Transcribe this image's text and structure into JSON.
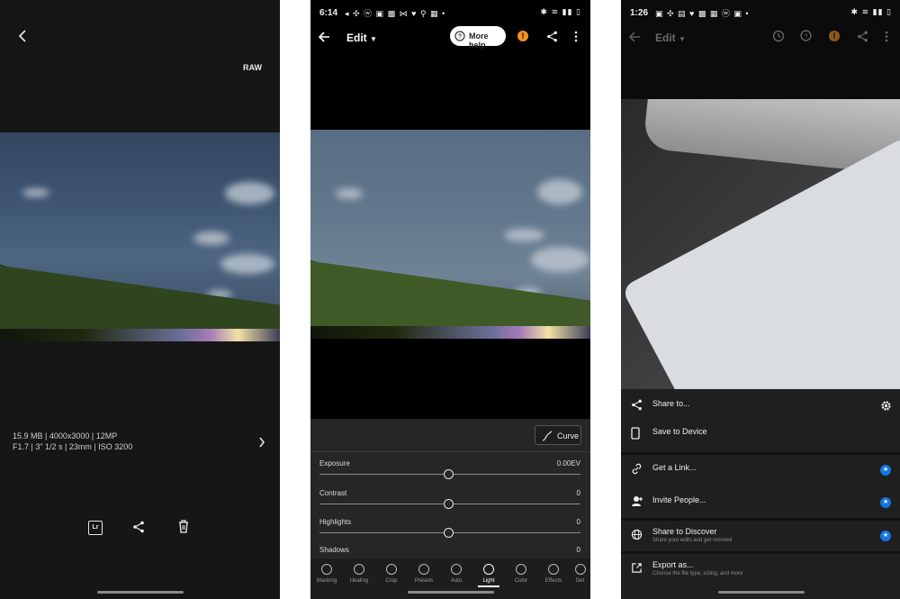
{
  "panel1": {
    "raw_badge": "RAW",
    "meta_line1": "15.9 MB  |  4000x3000  |  12MP",
    "meta_line2": "F1.7  |  3\" 1/2 s  |  23mm  |  ISO 3200",
    "actions": {
      "lr_label": "Lr"
    }
  },
  "panel2": {
    "status_time": "6:14",
    "status_left": "◂ ✣ ⓦ ▣ ▩ ⋈ ♥ ⚲ ▦ •",
    "status_right": "✱ ≋ ▮▮ ▯",
    "title": "Edit",
    "help_label": "More help",
    "curve_label": "Curve",
    "sliders": [
      {
        "label": "Exposure",
        "value": "0.00EV"
      },
      {
        "label": "Contrast",
        "value": "0"
      },
      {
        "label": "Highlights",
        "value": "0"
      },
      {
        "label": "Shadows",
        "value": "0"
      }
    ],
    "tools": [
      "Masking",
      "Healing",
      "Crop",
      "Presets",
      "Auto",
      "Light",
      "Color",
      "Effects",
      "Det"
    ],
    "active_tool": "Light"
  },
  "panel3": {
    "status_time": "1:26",
    "status_left": "▣ ✣ ▤ ♥ ▩ ▦ ⓦ ▣ •",
    "status_right": "✱ ≋ ▮▮ ▯",
    "title": "Edit",
    "sheet": {
      "share_to": "Share to...",
      "save_to_device": "Save to Device",
      "get_link": "Get a Link...",
      "invite_people": "Invite People...",
      "share_discover": "Share to Discover",
      "share_discover_sub": "Share your edits and get remixed",
      "export_as": "Export as...",
      "export_as_sub": "Choose the file type, sizing, and more"
    }
  },
  "colors": {
    "accent_blue": "#1473e6",
    "warning_orange": "#f29423"
  }
}
